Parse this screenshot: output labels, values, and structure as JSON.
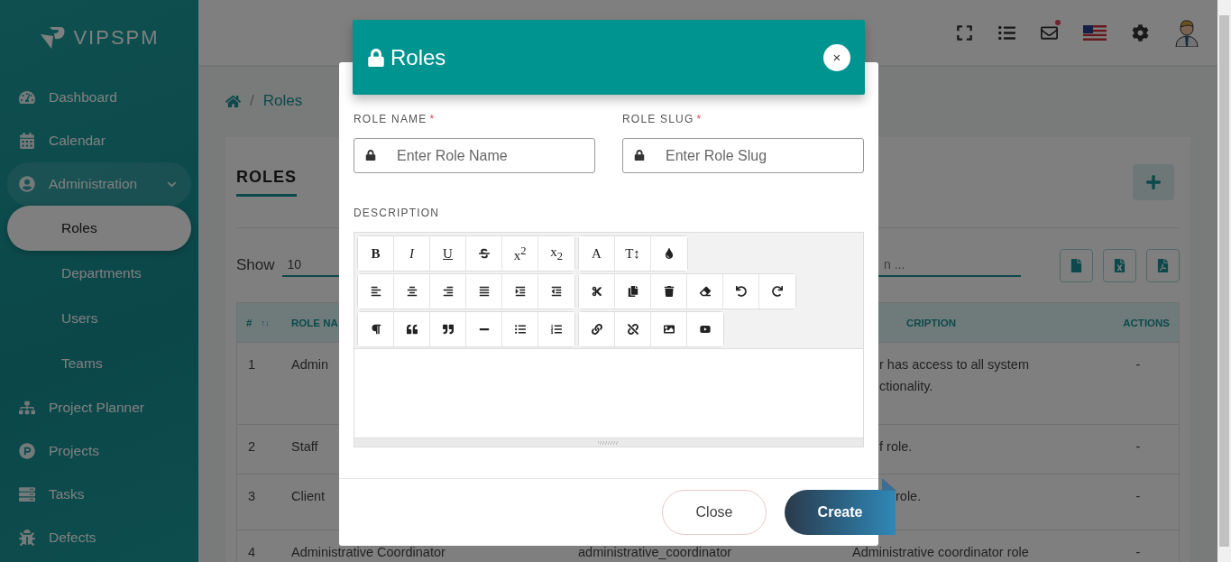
{
  "brand": {
    "name": "VIPSPM"
  },
  "sidebar": {
    "items": [
      {
        "label": "Dashboard",
        "expanded": false,
        "selected": false
      },
      {
        "label": "Calendar",
        "expanded": false,
        "selected": false
      },
      {
        "label": "Administration",
        "expanded": true,
        "selected": false,
        "children": [
          {
            "label": "Roles",
            "selected": true
          },
          {
            "label": "Departments",
            "selected": false
          },
          {
            "label": "Users",
            "selected": false
          },
          {
            "label": "Teams",
            "selected": false
          }
        ]
      },
      {
        "label": "Project Planner",
        "expanded": false,
        "selected": false
      },
      {
        "label": "Projects",
        "expanded": false,
        "selected": false
      },
      {
        "label": "Tasks",
        "expanded": false,
        "selected": false
      },
      {
        "label": "Defects",
        "expanded": false,
        "selected": false
      }
    ]
  },
  "header": {
    "mail_unread": true
  },
  "breadcrumb": {
    "separator": "/",
    "current": "Roles"
  },
  "card": {
    "title": "ROLES",
    "show_label": "Show",
    "page_size": "10",
    "search_fragment": "n ...",
    "columns": [
      "#",
      "↑↓",
      "ROLE NA",
      "CRIPTION",
      "ACTIONS"
    ],
    "rows": [
      {
        "number": "1",
        "name": "Admin",
        "slug": "",
        "description": "r has access to all system",
        "description_2": "ctionality.",
        "actions": "-"
      },
      {
        "number": "2",
        "name": "Staff",
        "slug": "",
        "description": "f role.",
        "description_2": "",
        "actions": "-"
      },
      {
        "number": "3",
        "name": "Client",
        "slug": "",
        "description": "role.",
        "description_2": "",
        "actions": "-"
      },
      {
        "number": "4",
        "name": "Administrative Coordinator",
        "slug": "administrative_coordinator",
        "description": "Administrative coordinator role",
        "description_2": "",
        "actions": "-"
      }
    ]
  },
  "modal": {
    "title": "Roles",
    "close_symbol": "×",
    "fields": [
      {
        "label": "ROLE NAME",
        "required": true,
        "placeholder": "Enter Role Name"
      },
      {
        "label": "ROLE SLUG",
        "required": true,
        "placeholder": "Enter Role Slug"
      }
    ],
    "required_mark": "*",
    "description_label": "DESCRIPTION",
    "toolbar": [
      [
        [
          {
            "kind": "text",
            "label": "B"
          },
          {
            "kind": "text",
            "label": "I"
          },
          {
            "kind": "text",
            "label": "U"
          },
          {
            "kind": "icon"
          },
          {
            "kind": "text",
            "label": "x$^{2}$"
          },
          {
            "kind": "text",
            "label": "x$_{2}$"
          }
        ],
        [
          {
            "kind": "text",
            "label": "A"
          },
          {
            "kind": "text",
            "label": "T↕"
          },
          {
            "kind": "icon"
          }
        ]
      ],
      [
        [
          {
            "kind": "icon"
          },
          {
            "kind": "icon"
          },
          {
            "kind": "icon"
          },
          {
            "kind": "icon"
          },
          {
            "kind": "icon"
          },
          {
            "kind": "icon"
          }
        ],
        [
          {
            "kind": "icon"
          },
          {
            "kind": "icon"
          },
          {
            "kind": "icon"
          },
          {
            "kind": "icon"
          },
          {
            "kind": "icon"
          },
          {
            "kind": "icon"
          }
        ]
      ],
      [
        [
          {
            "kind": "icon"
          },
          {
            "kind": "icon"
          },
          {
            "kind": "icon"
          },
          {
            "kind": "icon"
          },
          {
            "kind": "icon"
          },
          {
            "kind": "icon"
          }
        ],
        [
          {
            "kind": "icon"
          },
          {
            "kind": "icon"
          },
          {
            "kind": "icon"
          },
          {
            "kind": "icon"
          }
        ]
      ]
    ],
    "buttons": [
      {
        "label": "Close",
        "kind": "secondary"
      },
      {
        "label": "Create",
        "kind": "primary"
      }
    ]
  }
}
